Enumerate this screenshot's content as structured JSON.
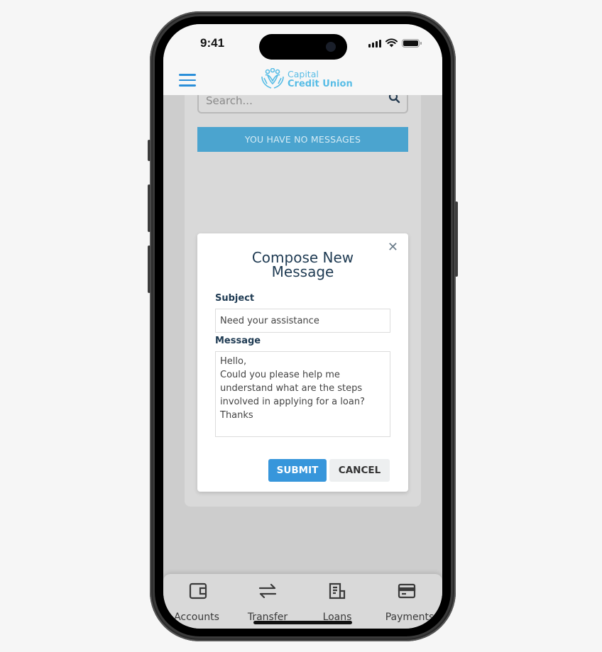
{
  "status_bar": {
    "time": "9:41"
  },
  "header": {
    "menu_icon": "hamburger-menu-icon",
    "logo": {
      "line1": "Capital",
      "line2": "Credit Union",
      "icon": "people-hands-logo-icon"
    },
    "brand_color": "#58bde6",
    "accent_color": "#2b8fd9"
  },
  "search": {
    "placeholder": "Search...",
    "icon": "search-icon"
  },
  "notice": {
    "text": "YOU HAVE NO MESSAGES",
    "color": "#4ba4cf"
  },
  "modal": {
    "title": "Compose New Message",
    "close_icon": "close-icon",
    "subject_label": "Subject",
    "subject_value": "Need your assistance",
    "message_label": "Message",
    "message_value": "Hello,\nCould you please help me understand what are the steps involved in applying for a loan?\nThanks",
    "submit_label": "SUBMIT",
    "cancel_label": "CANCEL",
    "submit_color": "#3796db"
  },
  "tabbar": {
    "items": [
      {
        "label": "Accounts",
        "icon": "wallet-icon"
      },
      {
        "label": "Transfer",
        "icon": "transfer-arrows-icon"
      },
      {
        "label": "Loans",
        "icon": "document-icon"
      },
      {
        "label": "Payments",
        "icon": "credit-card-icon"
      }
    ]
  }
}
